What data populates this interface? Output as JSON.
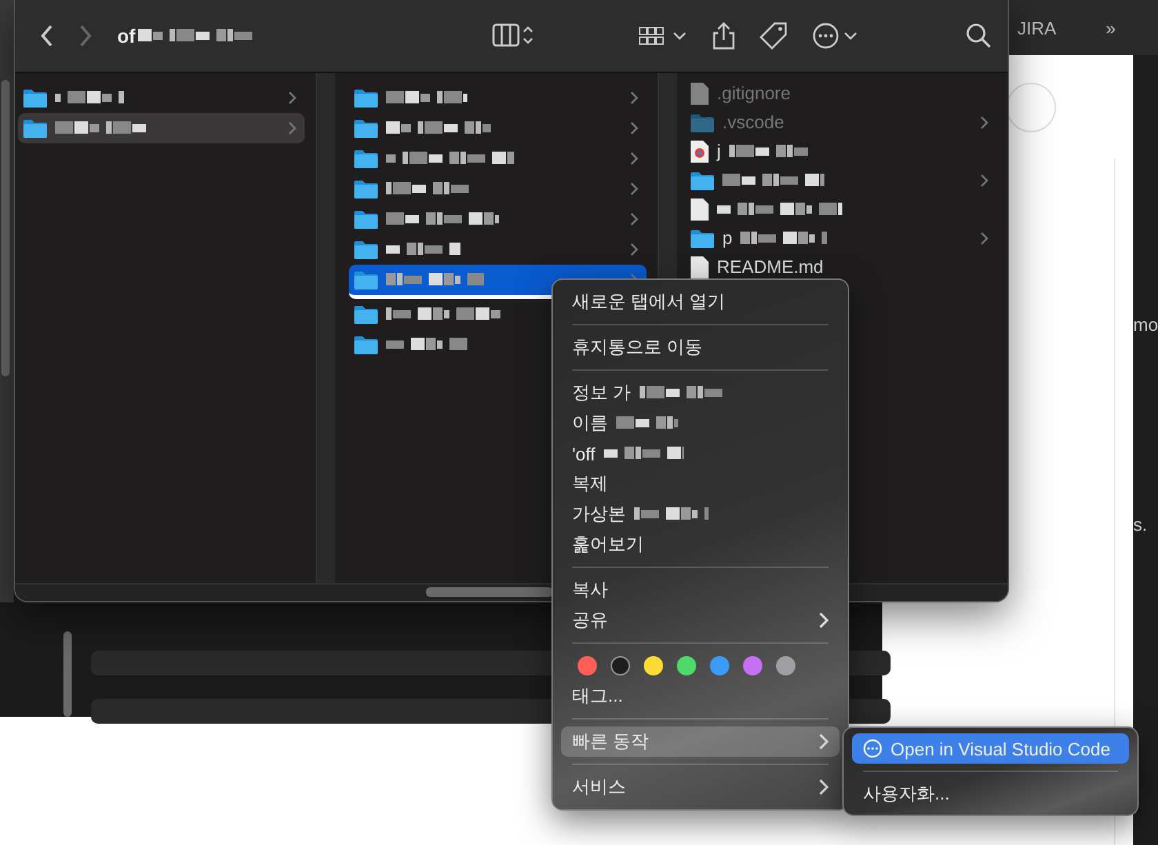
{
  "browser": {
    "tabs": [
      {
        "label": "JIRA"
      },
      {
        "label": "»"
      }
    ],
    "side_texts": [
      "mo",
      "s."
    ]
  },
  "finder": {
    "title": {
      "text": "of",
      "redacted": true
    },
    "columns": [
      {
        "items": [
          {
            "redacted": true,
            "kind": "folder",
            "has_children": true,
            "selected": false,
            "dimmed": false
          },
          {
            "redacted": true,
            "kind": "folder",
            "has_children": true,
            "selected": true,
            "dimmed": false
          }
        ]
      },
      {
        "items": [
          {
            "redacted": true,
            "kind": "folder",
            "has_children": true,
            "selected": false,
            "dimmed": false
          },
          {
            "redacted": true,
            "kind": "folder",
            "has_children": true,
            "selected": false,
            "dimmed": false
          },
          {
            "redacted": true,
            "kind": "folder",
            "has_children": true,
            "selected": false,
            "dimmed": false
          },
          {
            "redacted": true,
            "kind": "folder",
            "has_children": true,
            "selected": false,
            "dimmed": false
          },
          {
            "redacted": true,
            "kind": "folder",
            "has_children": true,
            "selected": false,
            "dimmed": false
          },
          {
            "redacted": true,
            "kind": "folder",
            "has_children": true,
            "selected": false,
            "dimmed": false
          },
          {
            "redacted": true,
            "kind": "folder",
            "has_children": true,
            "selected": true,
            "dimmed": false
          },
          {
            "redacted": true,
            "kind": "folder",
            "has_children": false,
            "selected": false,
            "dimmed": false
          },
          {
            "redacted": true,
            "kind": "folder",
            "has_children": false,
            "selected": false,
            "dimmed": false
          }
        ]
      },
      {
        "items": [
          {
            "name": ".gitignore",
            "redacted": false,
            "kind": "file",
            "has_children": false,
            "selected": false,
            "dimmed": true
          },
          {
            "name": ".vscode",
            "redacted": false,
            "kind": "folder",
            "has_children": true,
            "selected": false,
            "dimmed": true
          },
          {
            "name": "j",
            "redacted": true,
            "kind": "web",
            "has_children": false,
            "selected": false,
            "dimmed": false
          },
          {
            "redacted": true,
            "kind": "folder",
            "has_children": true,
            "selected": false,
            "dimmed": false
          },
          {
            "redacted": true,
            "kind": "file",
            "has_children": false,
            "selected": false,
            "dimmed": false
          },
          {
            "name": "p",
            "redacted": true,
            "kind": "folder",
            "has_children": true,
            "selected": false,
            "dimmed": false
          },
          {
            "name": "README.md",
            "redacted": false,
            "kind": "file",
            "has_children": false,
            "selected": false,
            "dimmed": false
          }
        ]
      }
    ]
  },
  "context_menu": {
    "items": [
      {
        "kind": "item",
        "label": "새로운 탭에서 열기",
        "redacted": false,
        "has_submenu": false,
        "selected": false
      },
      {
        "kind": "separator"
      },
      {
        "kind": "item",
        "label": "휴지통으로 이동",
        "redacted": false,
        "has_submenu": false,
        "selected": false
      },
      {
        "kind": "separator"
      },
      {
        "kind": "item",
        "label": "정보 가",
        "redacted": true,
        "has_submenu": false,
        "selected": false
      },
      {
        "kind": "item",
        "label": "이름",
        "redacted": true,
        "has_submenu": false,
        "selected": false
      },
      {
        "kind": "item",
        "label": "'off",
        "redacted": true,
        "has_submenu": false,
        "selected": false
      },
      {
        "kind": "item",
        "label": "복제",
        "redacted": false,
        "has_submenu": false,
        "selected": false
      },
      {
        "kind": "item",
        "label": "가상본",
        "redacted": true,
        "has_submenu": false,
        "selected": false
      },
      {
        "kind": "item",
        "label": "훑어보기",
        "redacted": false,
        "has_submenu": false,
        "selected": false
      },
      {
        "kind": "separator"
      },
      {
        "kind": "item",
        "label": "복사",
        "redacted": false,
        "has_submenu": false,
        "selected": false
      },
      {
        "kind": "item",
        "label": "공유",
        "redacted": false,
        "has_submenu": true,
        "selected": false
      },
      {
        "kind": "separator"
      },
      {
        "kind": "tags",
        "colors": [
          {
            "color": "#fe5f57"
          },
          {
            "color": "#1e1e1e"
          },
          {
            "color": "#fddb32"
          },
          {
            "color": "#4ed96a"
          },
          {
            "color": "#3b9cf8"
          },
          {
            "color": "#c56ff2"
          },
          {
            "color": "#a0a0a4"
          }
        ]
      },
      {
        "kind": "item",
        "label": "태그...",
        "redacted": false,
        "has_submenu": false,
        "selected": false
      },
      {
        "kind": "separator"
      },
      {
        "kind": "item",
        "label": "빠른 동작",
        "redacted": false,
        "has_submenu": true,
        "selected": true
      },
      {
        "kind": "separator"
      },
      {
        "kind": "item",
        "label": "서비스",
        "redacted": false,
        "has_submenu": true,
        "selected": false
      }
    ]
  },
  "submenu": {
    "items": [
      {
        "kind": "item",
        "label": "Open in Visual Studio Code",
        "has_icon": true,
        "selected": true
      },
      {
        "kind": "separator"
      },
      {
        "kind": "item",
        "label": "사용자화...",
        "has_icon": false,
        "selected": false
      }
    ]
  }
}
